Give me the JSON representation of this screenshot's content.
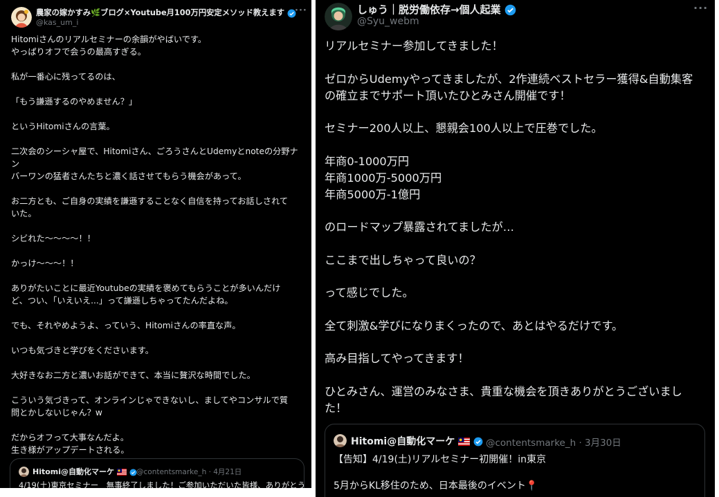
{
  "left_tweet": {
    "author_name": "農家の嫁かすみ🌿ブログ×Youtube月100万円安定メソッド教えます",
    "handle": "@kas_um_i",
    "more_label": "···",
    "paragraphs": [
      "Hitomiさんのリアルセミナーの余韻がやばいです。\nやっぱりオフで会うの最高すぎる。",
      "私が一番心に残ってるのは、",
      "「もう謙遜するのやめません？」",
      "というHitomiさんの言葉。",
      "二次会のシーシャ屋で、Hitomiさん、ごろうさんとUdemyとnoteの分野ナン\nバーワンの猛者さんたちと濃く話させてもらう機会があって。",
      "お二方とも、ご自身の実績を謙遜することなく自信を持ってお話しされて\nいた。",
      "シビれた〜〜〜〜！！",
      "かっけ〜〜〜！！",
      "ありがたいことに最近Youtubeの実績を褒めてもらうことが多いんだけ\nど、つい、「いえいえ...」って謙遜しちゃってたんだよね。",
      "でも、それやめようよ、っていう、Hitomiさんの率直な声。",
      "いつも気づきと学びをくださいます。",
      "大好きなお二方と濃いお話ができて、本当に贅沢な時間でした。",
      "こういう気づきって、オンラインじゃできないし、ましてやコンサルで質\n問とかしないじゃん？w",
      "だからオフって大事なんだよ。\n生き様がアップデートされる。"
    ],
    "quote": {
      "name": "Hitomi@自動化マーケ",
      "handle": "@contentsmarke_h",
      "date": "· 4月21日",
      "text": "4/19(土)東京セミナー　無事終了しました！ご参加いただいた皆様、ありがとう"
    }
  },
  "right_tweet": {
    "author_name": "しゅう｜脱労働依存→個人起業",
    "handle": "@Syu_webm",
    "more_label": "···",
    "paragraphs": [
      "リアルセミナー参加してきました！",
      "ゼロからUdemyやってきましたが、2作連続ベストセラー獲得&自動集客\nの確立までサポート頂いたひとみさん開催です！",
      "セミナー200人以上、懇親会100人以上で圧巻でした。",
      "年商0-1000万円\n年商1000万-5000万円\n年商5000万-1億円",
      "のロードマップ暴露されてましたが…",
      "ここまで出しちゃって良いの？",
      "って感じでした。",
      "全て刺激&学びになりまくったので、あとはやるだけです。",
      "高み目指してやってきます！",
      "ひとみさん、運営のみなさま、貴重な機会を頂きありがとうございまし\nた！"
    ],
    "quote": {
      "name": "Hitomi@自動化マーケ",
      "handle": "@contentsmarke_h",
      "date": "· 3月30日",
      "line1": "【告知】4/19(土)リアルセミナー初開催！in東京",
      "line2": "5月からKL移住のため、日本最後のイベント📍"
    }
  },
  "colors": {
    "background": "#000000",
    "text": "#e7e9ea",
    "secondary": "#71767b",
    "verified": "#1d9bf0",
    "border": "#2f3336"
  }
}
